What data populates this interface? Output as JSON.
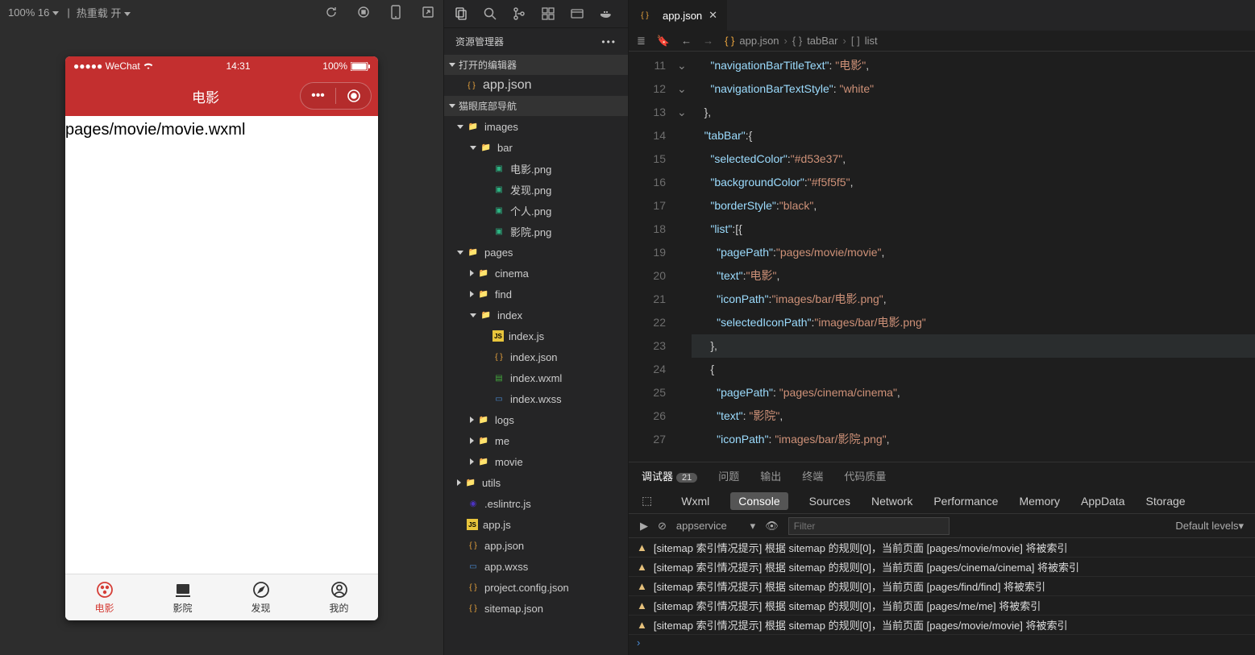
{
  "toolbar": {
    "zoom": "100% 16",
    "hotreload": "热重载 开"
  },
  "simulator": {
    "statusbar": {
      "carrier": "●●●●● WeChat",
      "wifi": "≋",
      "time": "14:31",
      "battery_pct": "100%"
    },
    "navbar": {
      "title": "电影"
    },
    "body_text": "pages/movie/movie.wxml",
    "tabs": [
      {
        "label": "电影",
        "active": true
      },
      {
        "label": "影院",
        "active": false
      },
      {
        "label": "发现",
        "active": false
      },
      {
        "label": "我的",
        "active": false
      }
    ]
  },
  "explorer": {
    "title": "资源管理器",
    "open_editors_header": "打开的编辑器",
    "open_editors": [
      {
        "name": "app.json"
      }
    ],
    "project_header": "猫眼底部导航",
    "tree": [
      {
        "type": "folder",
        "name": "images",
        "depth": 1,
        "open": true
      },
      {
        "type": "folder",
        "name": "bar",
        "depth": 2,
        "open": true
      },
      {
        "type": "img",
        "name": "电影.png",
        "depth": 3
      },
      {
        "type": "img",
        "name": "发现.png",
        "depth": 3
      },
      {
        "type": "img",
        "name": "个人.png",
        "depth": 3
      },
      {
        "type": "img",
        "name": "影院.png",
        "depth": 3
      },
      {
        "type": "folder",
        "name": "pages",
        "depth": 1,
        "open": true
      },
      {
        "type": "folder",
        "name": "cinema",
        "depth": 2,
        "open": false
      },
      {
        "type": "folder",
        "name": "find",
        "depth": 2,
        "open": false
      },
      {
        "type": "folder",
        "name": "index",
        "depth": 2,
        "open": true
      },
      {
        "type": "js",
        "name": "index.js",
        "depth": 3
      },
      {
        "type": "json",
        "name": "index.json",
        "depth": 3
      },
      {
        "type": "wxml",
        "name": "index.wxml",
        "depth": 3
      },
      {
        "type": "wxss",
        "name": "index.wxss",
        "depth": 3
      },
      {
        "type": "folder",
        "name": "logs",
        "depth": 2,
        "open": false
      },
      {
        "type": "folder",
        "name": "me",
        "depth": 2,
        "open": false
      },
      {
        "type": "folder",
        "name": "movie",
        "depth": 2,
        "open": false
      },
      {
        "type": "folder",
        "name": "utils",
        "depth": 1,
        "open": false
      },
      {
        "type": "eslint",
        "name": ".eslintrc.js",
        "depth": 1
      },
      {
        "type": "js",
        "name": "app.js",
        "depth": 1
      },
      {
        "type": "json",
        "name": "app.json",
        "depth": 1
      },
      {
        "type": "wxss",
        "name": "app.wxss",
        "depth": 1
      },
      {
        "type": "json",
        "name": "project.config.json",
        "depth": 1
      },
      {
        "type": "json",
        "name": "sitemap.json",
        "depth": 1
      }
    ]
  },
  "editor": {
    "tab_name": "app.json",
    "breadcrumb": [
      "app.json",
      "tabBar",
      "list"
    ],
    "lines": [
      {
        "n": 11,
        "ind": 3,
        "tokens": [
          [
            "key",
            "\"navigationBarTitleText\""
          ],
          [
            "punc",
            ": "
          ],
          [
            "str",
            "\"电影\""
          ],
          [
            "punc",
            ","
          ]
        ]
      },
      {
        "n": 12,
        "ind": 3,
        "tokens": [
          [
            "key",
            "\"navigationBarTextStyle\""
          ],
          [
            "punc",
            ": "
          ],
          [
            "str",
            "\"white\""
          ]
        ]
      },
      {
        "n": 13,
        "ind": 2,
        "tokens": [
          [
            "punc",
            "},"
          ]
        ]
      },
      {
        "n": 14,
        "ind": 2,
        "fold": "down",
        "tokens": [
          [
            "key",
            "\"tabBar\""
          ],
          [
            "punc",
            ":{"
          ]
        ]
      },
      {
        "n": 15,
        "ind": 3,
        "tokens": [
          [
            "key",
            "\"selectedColor\""
          ],
          [
            "punc",
            ":"
          ],
          [
            "str",
            "\"#d53e37\""
          ],
          [
            "punc",
            ","
          ]
        ]
      },
      {
        "n": 16,
        "ind": 3,
        "tokens": [
          [
            "key",
            "\"backgroundColor\""
          ],
          [
            "punc",
            ":"
          ],
          [
            "str",
            "\"#f5f5f5\""
          ],
          [
            "punc",
            ","
          ]
        ]
      },
      {
        "n": 17,
        "ind": 3,
        "tokens": [
          [
            "key",
            "\"borderStyle\""
          ],
          [
            "punc",
            ":"
          ],
          [
            "str",
            "\"black\""
          ],
          [
            "punc",
            ","
          ]
        ]
      },
      {
        "n": 18,
        "ind": 3,
        "fold": "down",
        "tokens": [
          [
            "key",
            "\"list\""
          ],
          [
            "punc",
            ":[{"
          ]
        ]
      },
      {
        "n": 19,
        "ind": 4,
        "tokens": [
          [
            "key",
            "\"pagePath\""
          ],
          [
            "punc",
            ":"
          ],
          [
            "str",
            "\"pages/movie/movie\""
          ],
          [
            "punc",
            ","
          ]
        ]
      },
      {
        "n": 20,
        "ind": 4,
        "tokens": [
          [
            "key",
            "\"text\""
          ],
          [
            "punc",
            ":"
          ],
          [
            "str",
            "\"电影\""
          ],
          [
            "punc",
            ","
          ]
        ]
      },
      {
        "n": 21,
        "ind": 4,
        "tokens": [
          [
            "key",
            "\"iconPath\""
          ],
          [
            "punc",
            ":"
          ],
          [
            "str",
            "\"images/bar/电影.png\""
          ],
          [
            "punc",
            ","
          ]
        ]
      },
      {
        "n": 22,
        "ind": 4,
        "tokens": [
          [
            "key",
            "\"selectedIconPath\""
          ],
          [
            "punc",
            ":"
          ],
          [
            "str",
            "\"images/bar/电影.png\""
          ]
        ]
      },
      {
        "n": 23,
        "ind": 3,
        "hl": true,
        "tokens": [
          [
            "punc",
            "},"
          ]
        ]
      },
      {
        "n": 24,
        "ind": 3,
        "fold": "down",
        "tokens": [
          [
            "punc",
            "{"
          ]
        ]
      },
      {
        "n": 25,
        "ind": 4,
        "tokens": [
          [
            "key",
            "\"pagePath\""
          ],
          [
            "punc",
            ": "
          ],
          [
            "str",
            "\"pages/cinema/cinema\""
          ],
          [
            "punc",
            ","
          ]
        ]
      },
      {
        "n": 26,
        "ind": 4,
        "tokens": [
          [
            "key",
            "\"text\""
          ],
          [
            "punc",
            ": "
          ],
          [
            "str",
            "\"影院\""
          ],
          [
            "punc",
            ","
          ]
        ]
      },
      {
        "n": 27,
        "ind": 4,
        "tokens": [
          [
            "key",
            "\"iconPath\""
          ],
          [
            "punc",
            ": "
          ],
          [
            "str",
            "\"images/bar/影院.png\""
          ],
          [
            "punc",
            ","
          ]
        ]
      }
    ]
  },
  "panel": {
    "tabs": [
      {
        "label": "调试器",
        "badge": "21",
        "active": true
      },
      {
        "label": "问题"
      },
      {
        "label": "输出"
      },
      {
        "label": "终端"
      },
      {
        "label": "代码质量"
      }
    ],
    "devtabs": [
      "Wxml",
      "Console",
      "Sources",
      "Network",
      "Performance",
      "Memory",
      "AppData",
      "Storage"
    ],
    "devtab_active": "Console",
    "context": "appservice",
    "filter_placeholder": "Filter",
    "levels": "Default levels",
    "logs": [
      "[sitemap 索引情况提示] 根据 sitemap 的规则[0]，当前页面 [pages/movie/movie] 将被索引",
      "[sitemap 索引情况提示] 根据 sitemap 的规则[0]，当前页面 [pages/cinema/cinema] 将被索引",
      "[sitemap 索引情况提示] 根据 sitemap 的规则[0]，当前页面 [pages/find/find] 将被索引",
      "[sitemap 索引情况提示] 根据 sitemap 的规则[0]，当前页面 [pages/me/me] 将被索引",
      "[sitemap 索引情况提示] 根据 sitemap 的规则[0]，当前页面 [pages/movie/movie] 将被索引"
    ]
  }
}
